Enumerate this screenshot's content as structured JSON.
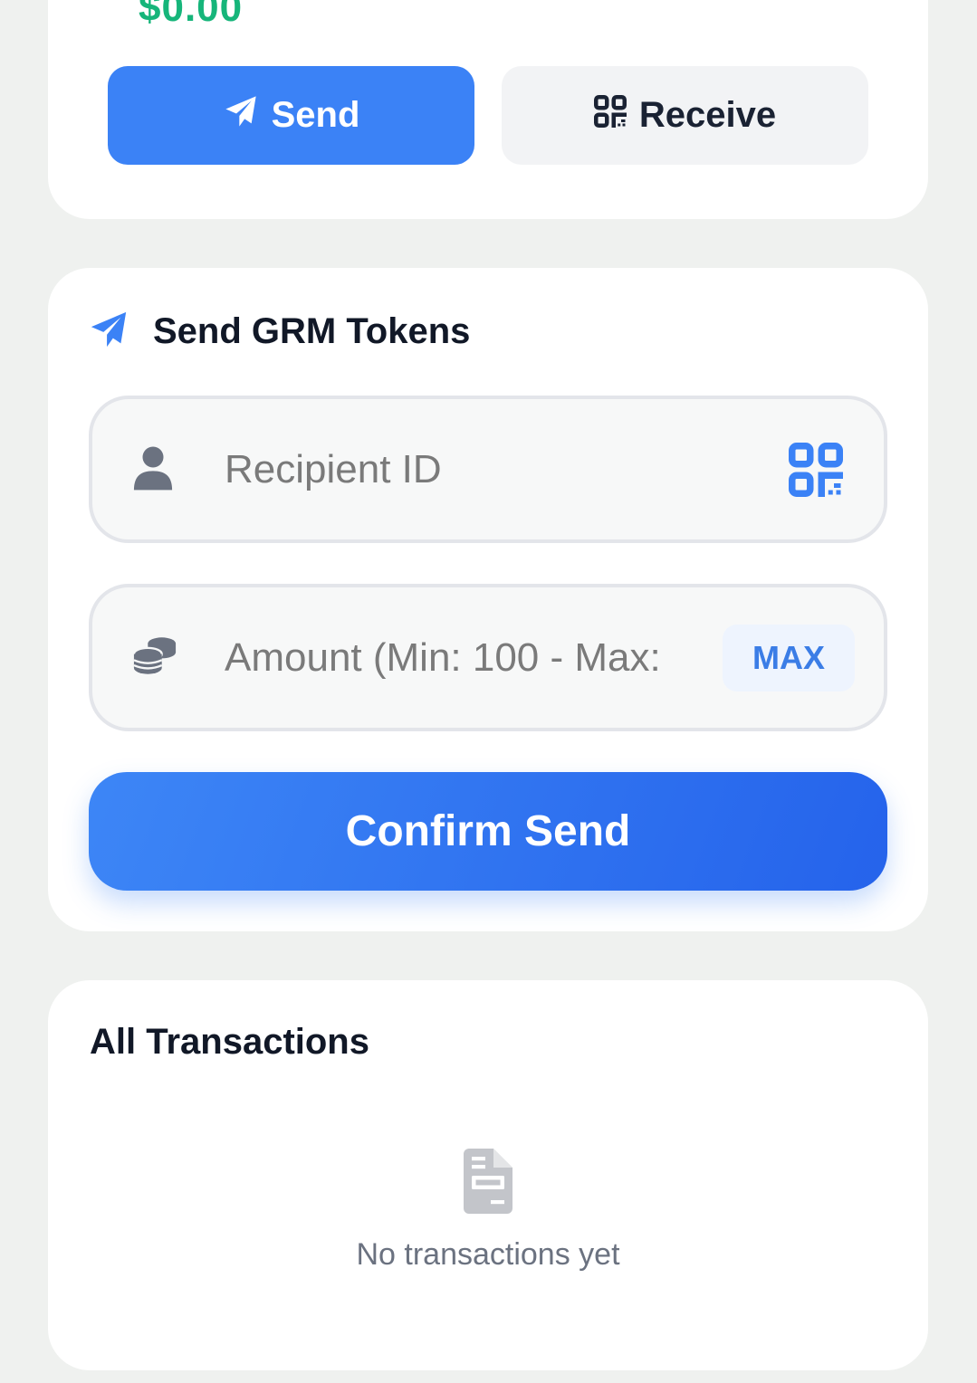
{
  "wallet": {
    "balance": "$0.00",
    "send_label": "Send",
    "receive_label": "Receive"
  },
  "send_form": {
    "title": "Send GRM Tokens",
    "recipient_placeholder": "Recipient ID",
    "amount_placeholder": "Amount (Min: 100 - Max:",
    "max_label": "MAX",
    "confirm_label": "Confirm Send"
  },
  "transactions": {
    "title": "All Transactions",
    "empty_text": "No transactions yet"
  },
  "colors": {
    "accent": "#3b82f6",
    "balance_green": "#16b57a",
    "background": "#eff1ef"
  },
  "icons": {
    "send": "paper-plane-icon",
    "receive": "qr-code-icon",
    "recipient": "user-icon",
    "amount": "coins-icon",
    "empty": "receipt-icon"
  }
}
